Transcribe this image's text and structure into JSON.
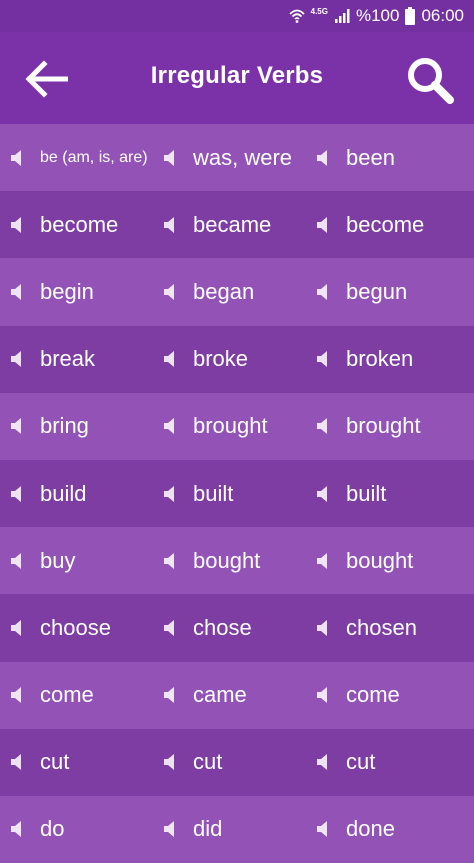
{
  "status_bar": {
    "network": "4.5G",
    "battery": "%100",
    "time": "06:00"
  },
  "app_bar": {
    "title": "Irregular Verbs",
    "back_icon": "arrow-left-icon",
    "search_icon": "search-icon"
  },
  "colors": {
    "appbar": "#7b32a8",
    "row_light": "#9352b5",
    "row_dark": "#7d3da2",
    "text": "#ffffff"
  },
  "verbs": [
    [
      "be (am, is, are)",
      "was, were",
      "been"
    ],
    [
      "become",
      "became",
      "become"
    ],
    [
      "begin",
      "began",
      "begun"
    ],
    [
      "break",
      "broke",
      "broken"
    ],
    [
      "bring",
      "brought",
      "brought"
    ],
    [
      "build",
      "built",
      "built"
    ],
    [
      "buy",
      "bought",
      "bought"
    ],
    [
      "choose",
      "chose",
      "chosen"
    ],
    [
      "come",
      "came",
      "come"
    ],
    [
      "cut",
      "cut",
      "cut"
    ],
    [
      "do",
      "did",
      "done"
    ]
  ]
}
